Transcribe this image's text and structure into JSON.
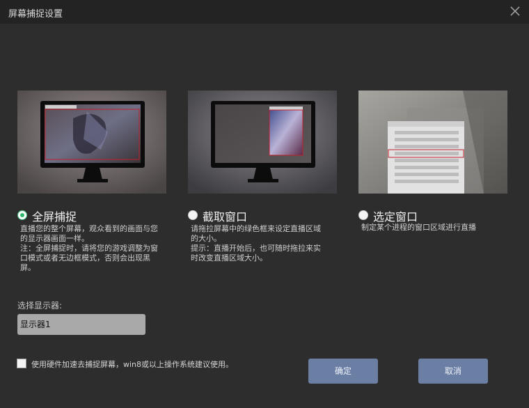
{
  "window": {
    "title": "屏幕捕捉设置"
  },
  "options": [
    {
      "label": "全屏捕捉",
      "selected": true,
      "description": "直播您的整个屏幕，观众看到的画面与您\n的显示器画面一样。\n注：全屏捕捉时，请将您的游戏调整为窗\n口模式或者无边框模式，否则会出现黑\n屏。"
    },
    {
      "label": "截取窗口",
      "selected": false,
      "description": "请拖拉屏幕中的绿色框来设定直播区域\n的大小。\n提示：直播开始后，也可随时拖拉来实\n时改变直播区域大小。"
    },
    {
      "label": "选定窗口",
      "selected": false,
      "description": "制定某个进程的窗口区域进行直播"
    }
  ],
  "monitor": {
    "label": "选择显示器:",
    "value": "显示器1"
  },
  "hardware": {
    "label": "使用硬件加速去捕捉屏幕，win8或以上操作系统建议使用。",
    "checked": false
  },
  "buttons": {
    "ok": "确定",
    "cancel": "取消"
  },
  "colors": {
    "accent_button": "#6a7fa3",
    "selected_radio": "#2fb86f",
    "capture_frame": "#c0202a"
  }
}
